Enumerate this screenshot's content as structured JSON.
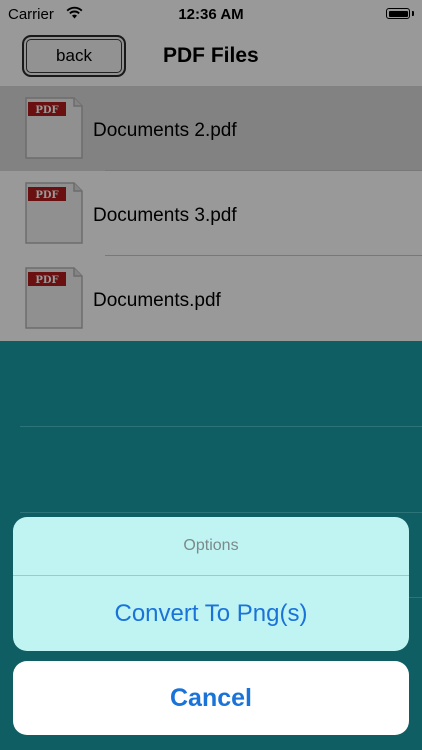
{
  "status_bar": {
    "carrier": "Carrier",
    "time": "12:36 AM"
  },
  "nav": {
    "back_label": "back",
    "title": "PDF Files"
  },
  "files": [
    {
      "name": "Documents 2.pdf",
      "selected": true
    },
    {
      "name": "Documents 3.pdf",
      "selected": false
    },
    {
      "name": "Documents.pdf",
      "selected": false
    }
  ],
  "pdf_badge": "PDF",
  "action_sheet": {
    "title": "Options",
    "convert_label": "Convert To Png(s)",
    "cancel_label": "Cancel"
  },
  "colors": {
    "accent": "#1a73d9",
    "sheet_background": "#bff4f2",
    "pdf_badge": "#b11c1c"
  }
}
